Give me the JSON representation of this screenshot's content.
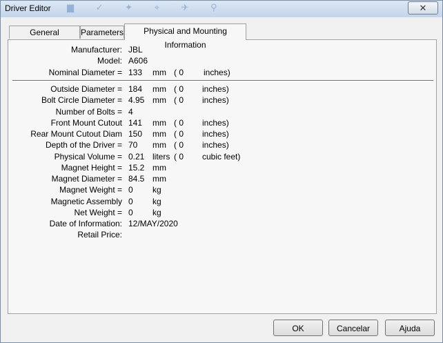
{
  "window": {
    "title": "Driver Editor",
    "close_glyph": "✕"
  },
  "tabs": [
    {
      "label": "General Information"
    },
    {
      "label": "Parameters"
    },
    {
      "label": "Physical and Mounting Information"
    }
  ],
  "fields": {
    "manufacturer": {
      "label": "Manufacturer:",
      "value": "JBL"
    },
    "model": {
      "label": "Model:",
      "value": "A606"
    },
    "nominal_diameter": {
      "label": "Nominal Diameter =",
      "value": "133",
      "unit": "mm",
      "paren": "( 0",
      "conv_unit": "inches)"
    },
    "outside_diameter": {
      "label": "Outside Diameter =",
      "value": "184",
      "unit": "mm",
      "paren": "( 0",
      "conv_unit": "inches)"
    },
    "bolt_circle_diameter": {
      "label": "Bolt Circle Diameter =",
      "value": "4.95",
      "unit": "mm",
      "paren": "( 0",
      "conv_unit": "inches)"
    },
    "number_of_bolts": {
      "label": "Number of Bolts =",
      "value": "4"
    },
    "front_mount_cutout": {
      "label": "Front Mount Cutout",
      "value": "141",
      "unit": "mm",
      "paren": "( 0",
      "conv_unit": "inches)"
    },
    "rear_mount_cutout": {
      "label": "Rear Mount Cutout Diam",
      "value": "150",
      "unit": "mm",
      "paren": "( 0",
      "conv_unit": "inches)"
    },
    "depth_of_driver": {
      "label": "Depth of the Driver =",
      "value": "70",
      "unit": "mm",
      "paren": "( 0",
      "conv_unit": "inches)"
    },
    "physical_volume": {
      "label": "Physical Volume =",
      "value": "0.21",
      "unit": "liters",
      "paren": "( 0",
      "conv_unit": "cubic feet)"
    },
    "magnet_height": {
      "label": "Magnet Height =",
      "value": "15.2",
      "unit": "mm"
    },
    "magnet_diameter": {
      "label": "Magnet Diameter =",
      "value": "84.5",
      "unit": "mm"
    },
    "magnet_weight": {
      "label": "Magnet Weight =",
      "value": "0",
      "unit": "kg"
    },
    "magnetic_assembly": {
      "label": "Magnetic Assembly",
      "value": "0",
      "unit": "kg"
    },
    "net_weight": {
      "label": "Net Weight =",
      "value": "0",
      "unit": "kg"
    },
    "date_of_information": {
      "label": "Date of Information:",
      "value": "12/MAY/2020"
    },
    "retail_price": {
      "label": "Retail Price:",
      "value": ""
    }
  },
  "buttons": {
    "ok": "OK",
    "cancel": "Cancelar",
    "help": "Ajuda"
  }
}
